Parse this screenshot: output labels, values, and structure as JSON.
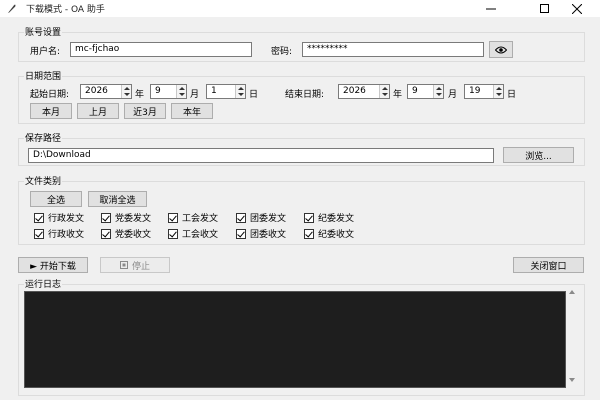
{
  "window": {
    "title": "下载模式 - OA 助手",
    "icon": "feather-icon",
    "controls": [
      "minimize-icon",
      "maximize-icon",
      "close-icon"
    ]
  },
  "account": {
    "group_label": "账号设置",
    "username_label": "用户名:",
    "username_value": "mc-fjchao",
    "password_label": "密码:",
    "password_value": "*********",
    "show_password_icon": "eye-icon"
  },
  "date_range": {
    "group_label": "日期范围",
    "start_label": "起始日期:",
    "start_year": "2026",
    "start_month": "9",
    "start_day": "1",
    "end_label": "结束日期:",
    "end_year": "2026",
    "end_month": "9",
    "end_day": "19",
    "year_unit": "年",
    "month_unit": "月",
    "day_unit": "日",
    "quick_buttons": [
      "本月",
      "上月",
      "近3月",
      "本年"
    ]
  },
  "save_path": {
    "group_label": "保存路径",
    "value": "D:\\Download",
    "browse_label": "浏览..."
  },
  "file_types": {
    "group_label": "文件类别",
    "select_all_label": "全选",
    "deselect_all_label": "取消全选",
    "row1": [
      "行政发文",
      "党委发文",
      "工会发文",
      "团委发文",
      "纪委发文"
    ],
    "row2": [
      "行政收文",
      "党委收文",
      "工会收文",
      "团委收文",
      "纪委收文"
    ]
  },
  "actions": {
    "start_label": "► 开始下载",
    "stop_label": "停止",
    "close_label": "关闭窗口"
  },
  "log": {
    "group_label": "运行日志"
  }
}
